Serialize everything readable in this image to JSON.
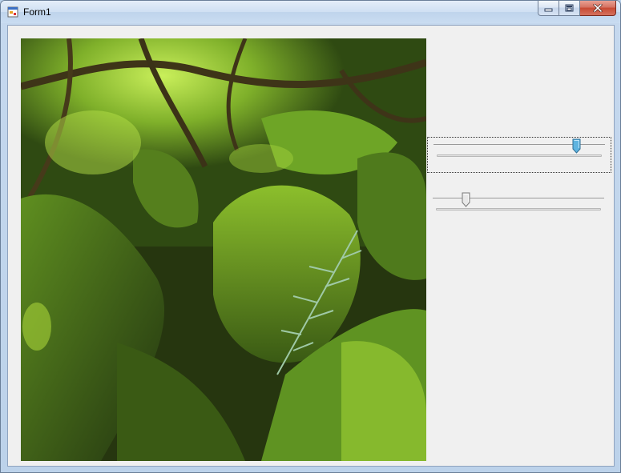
{
  "window": {
    "title": "Form1",
    "icon": "app-form-icon",
    "caption_buttons": [
      "minimize-icon",
      "maximize-icon",
      "close-icon"
    ]
  },
  "picture": {
    "content": "photo-mossy-forest",
    "colors": {
      "moss": "#4f7a1c",
      "light": "#a8d438",
      "shadow": "#1e2a0e"
    }
  },
  "trackbars": [
    {
      "name": "top-trackbar",
      "value_fraction": 0.84,
      "focused": true,
      "thumb_color": "#5fb4e0"
    },
    {
      "name": "bottom-trackbar",
      "value_fraction": 0.18,
      "focused": false,
      "thumb_color": "#e8e8e8"
    }
  ]
}
